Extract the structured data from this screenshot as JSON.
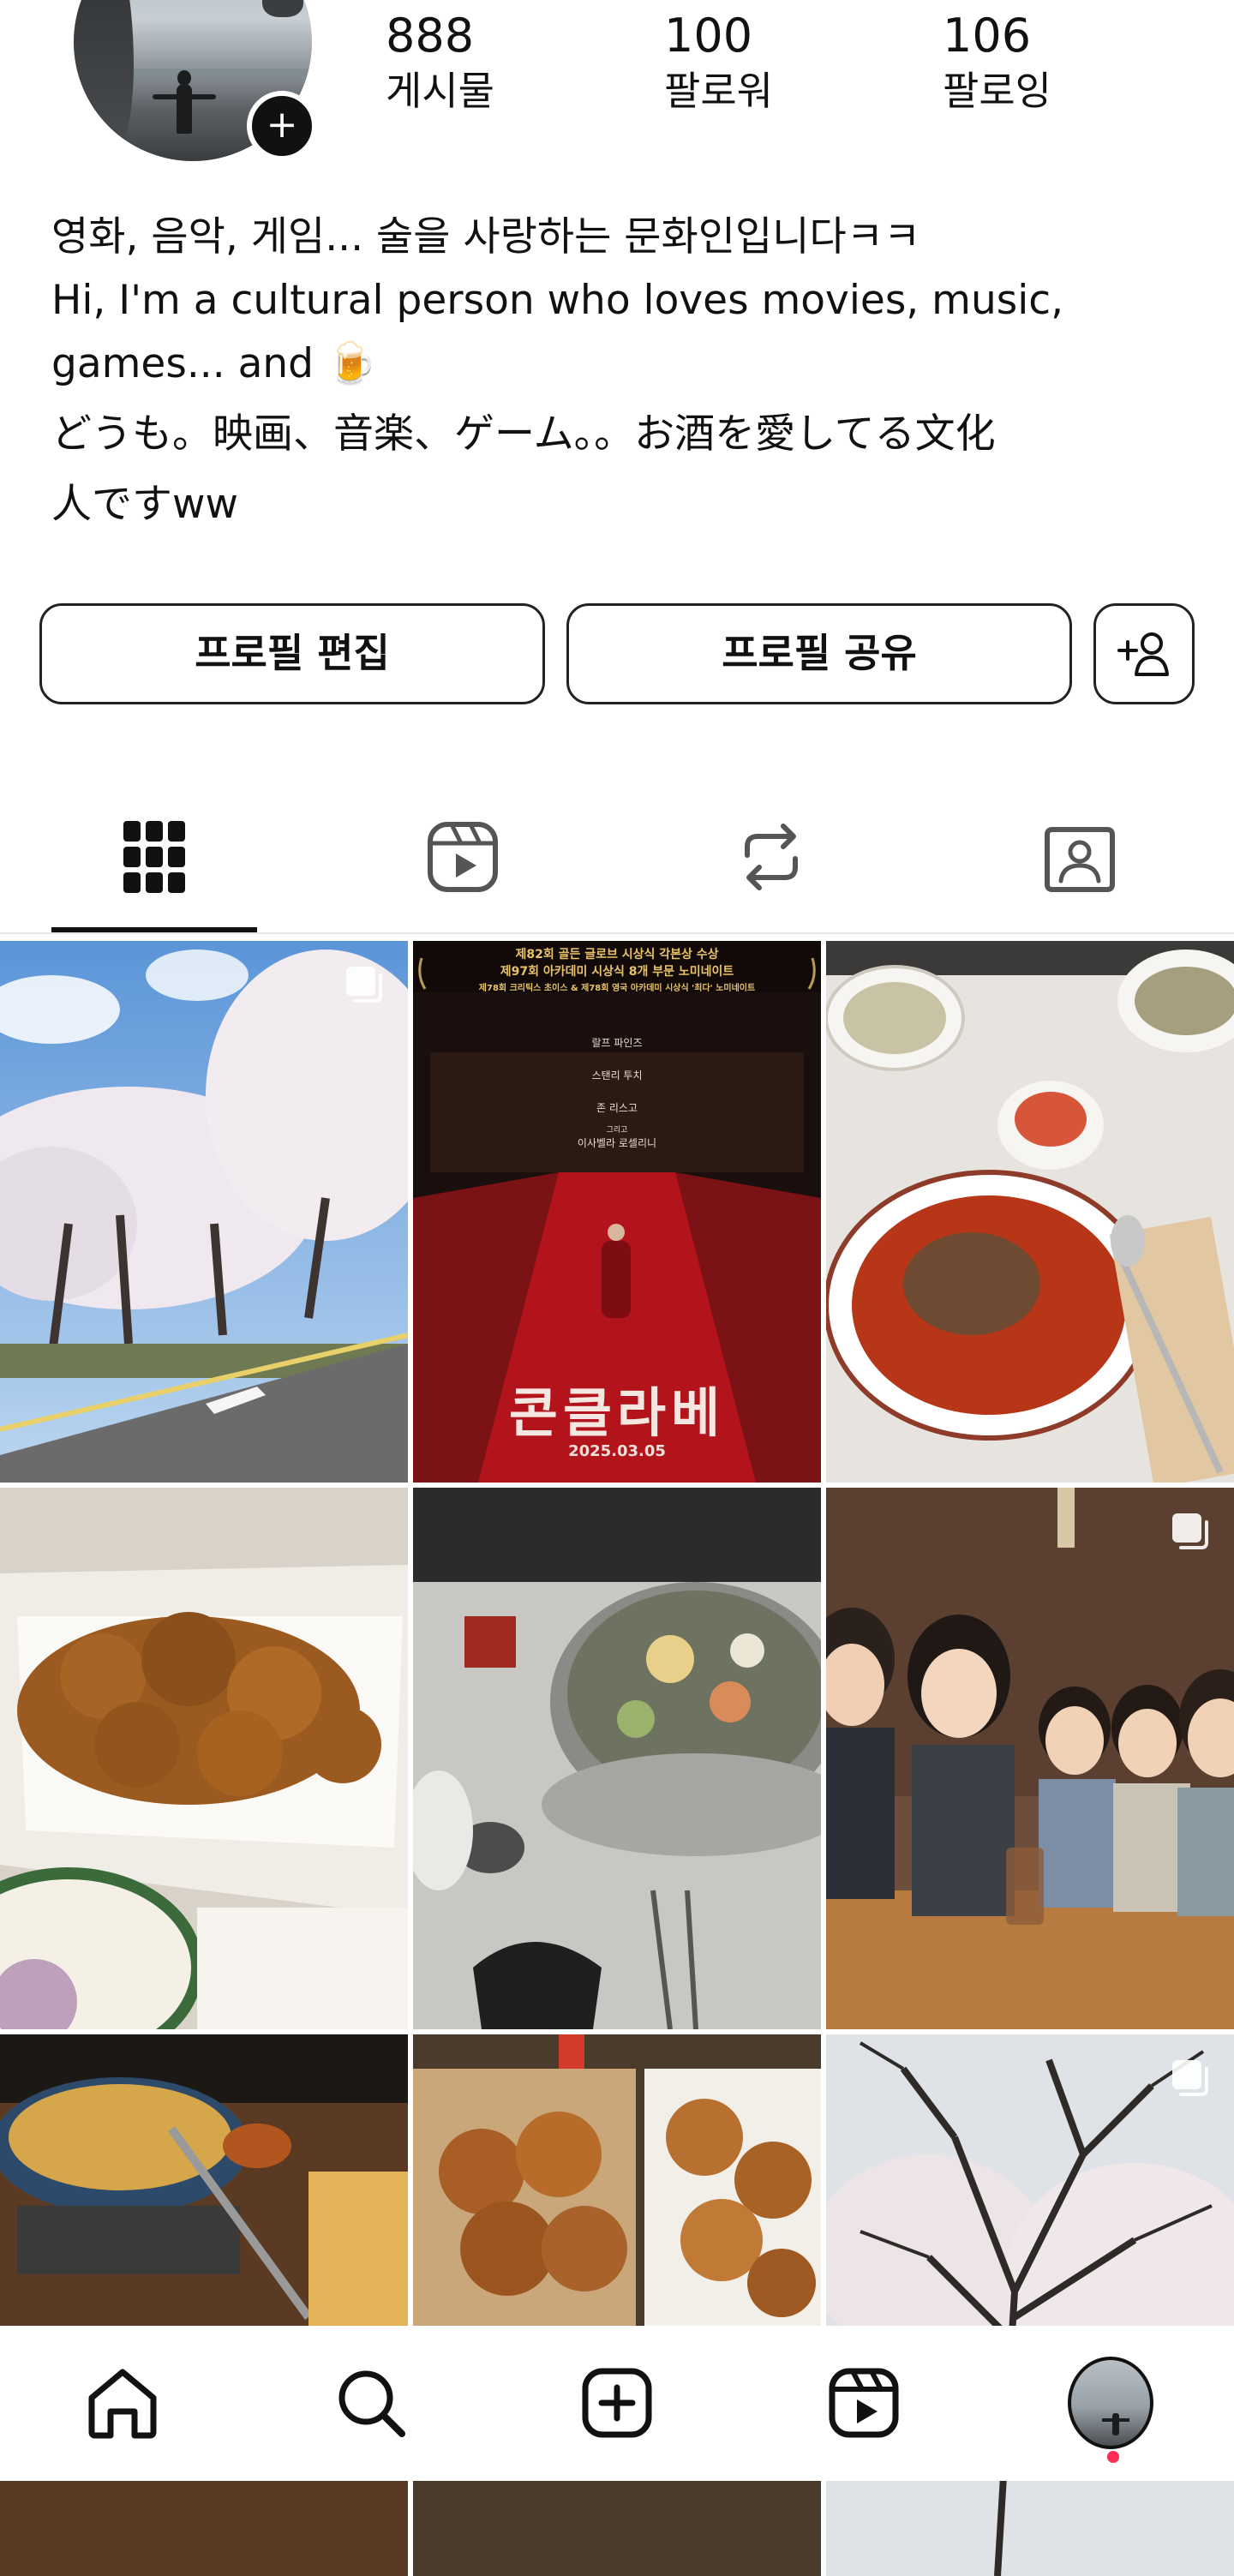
{
  "profile": {
    "stats": [
      {
        "count": "888",
        "label": "게시물"
      },
      {
        "count": "100",
        "label": "팔로워"
      },
      {
        "count": "106",
        "label": "팔로잉"
      }
    ],
    "bio_lines": [
      "영화, 음악, 게임... 술을 사랑하는 문화인입니다ㅋㅋ",
      "Hi, I'm a cultural person who loves movies, music,",
      "games... and 🍺",
      "どうも。映画、音楽、ゲーム。。お酒を愛してる文化",
      "人ですww"
    ]
  },
  "actions": {
    "edit_profile": "프로필 편집",
    "share_profile": "프로필 공유"
  },
  "tabs": [
    "posts-grid",
    "reels",
    "reposts",
    "tagged"
  ],
  "grid": {
    "posts": [
      {
        "name": "cherry-blossom-road",
        "multi": true
      },
      {
        "name": "conclave-movie-poster",
        "multi": false
      },
      {
        "name": "noodle-soup-table",
        "multi": false
      },
      {
        "name": "fried-chicken-box",
        "multi": false
      },
      {
        "name": "hotpot-dinner",
        "multi": false
      },
      {
        "name": "animated-group-photo",
        "multi": true
      },
      {
        "name": "ramen-pot",
        "multi": false
      },
      {
        "name": "fried-chicken-takeout",
        "multi": false
      },
      {
        "name": "bare-tree-blossoms",
        "multi": true
      }
    ],
    "poster": {
      "top_lines": [
        "제82회 골든 글로브 시상식 각본상 수상",
        "제97회 아카데미 시상식 8개 부문 노미네이트",
        "제78회 크리틱스 초이스 & 제78회 영국 아카데미 시상식 '최다' 노미네이트"
      ],
      "cast": [
        "랄프 파인즈",
        "스탠리 투치",
        "존 리스고",
        "그리고",
        "이사벨라 로셀리니"
      ],
      "title": "콘클라베",
      "date": "2025.03.05"
    }
  },
  "bottom_nav": [
    "home",
    "search",
    "create",
    "reels",
    "profile"
  ],
  "colors": {
    "text": "#111111",
    "border": "#222222",
    "notification": "#ff2d55",
    "poster_red": "#b3141c"
  }
}
